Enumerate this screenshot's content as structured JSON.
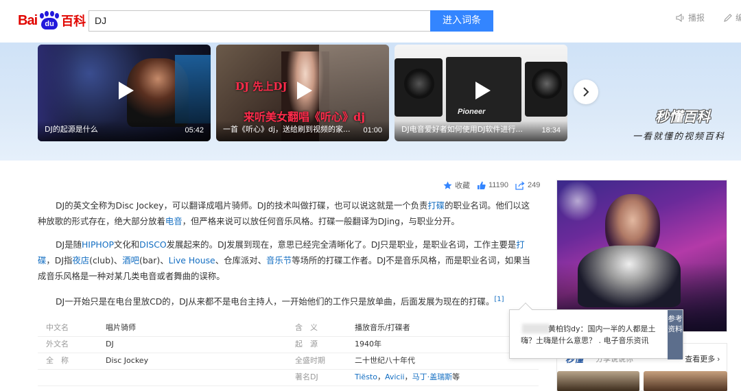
{
  "header": {
    "logo_text_left": "Bai",
    "logo_text_paw": "du",
    "logo_text_right": "百科",
    "search_value": "DJ",
    "search_button": "进入词条",
    "broadcast_label": "播报",
    "edit_label": "编"
  },
  "videos": [
    {
      "title": "DJ的起源是什么",
      "duration": "05:42",
      "overlay_1": "",
      "overlay_2": ""
    },
    {
      "title": "一首《听心》dj，送给刷到视频的家...",
      "duration": "01:00",
      "overlay_1": "DJ 先上DJ",
      "overlay_2": "来听美女翻唱《听心》dj"
    },
    {
      "title": "DJ电音爱好者如何使用DJ软件进行...",
      "duration": "18:34",
      "overlay_1": "",
      "overlay_2": "Pioneer"
    }
  ],
  "banner": {
    "brand": "秒懂百科",
    "slogan": "一看就懂的视频百科"
  },
  "stats": {
    "favorite_label": "收藏",
    "like_count": "11190",
    "share_count": "249"
  },
  "paragraphs": {
    "p1": [
      {
        "t": "DJ的英文全称为Disc Jockey，可以翻译成唱片骑师。DJ的技术叫做打碟，也可以说这就是一个负责"
      },
      {
        "t": "打碟",
        "link": true
      },
      {
        "t": "的职业名词。他们以这种放歌的形式存在，绝大部分放着"
      },
      {
        "t": "电音",
        "link": true
      },
      {
        "t": "，但严格来说可以放任何音乐风格。打碟一般翻译为DJing，与职业分开。"
      }
    ],
    "p2": [
      {
        "t": "DJ是随"
      },
      {
        "t": "HIPHOP",
        "link": true
      },
      {
        "t": "文化和"
      },
      {
        "t": "DISCO",
        "link": true
      },
      {
        "t": "发展起来的。DJ发展到现在，意思已经完全清晰化了。DJ只是职业，是职业名词，工作主要是"
      },
      {
        "t": "打碟",
        "link": true
      },
      {
        "t": "，DJ指"
      },
      {
        "t": "夜店",
        "link": true
      },
      {
        "t": "(club)、"
      },
      {
        "t": "酒吧",
        "link": true
      },
      {
        "t": "(bar)、"
      },
      {
        "t": "Live House",
        "link": true
      },
      {
        "t": "、仓库派对、"
      },
      {
        "t": "音乐节",
        "link": true
      },
      {
        "t": "等场所的打碟工作者。DJ不是音乐风格，而是职业名词，如果当成音乐风格是一种对某几类电音或者舞曲的误称。"
      }
    ],
    "p3": [
      {
        "t": "DJ一开始只是在电台里放CD的，DJ从来都不是电台主持人，一开始他们的工作只是放单曲，后面发展为现在的打碟。"
      },
      {
        "t": "[1]",
        "sup": true
      }
    ]
  },
  "basic_info": {
    "left": [
      {
        "key": "中文名",
        "value": "唱片骑师"
      },
      {
        "key": "外文名",
        "value": "DJ"
      },
      {
        "key": "全　称",
        "value": "Disc Jockey"
      }
    ],
    "right": [
      {
        "key": "含　义",
        "value": "播放音乐/打碟者"
      },
      {
        "key": "起　源",
        "value": "1940年"
      },
      {
        "key": "全盛时期",
        "value": "二十世纪八十年代"
      },
      {
        "key": "著名DJ",
        "value_links": [
          "Tiësto",
          "Avicii",
          "马丁·盖瑞斯"
        ],
        "value_suffix": "等"
      }
    ]
  },
  "tooltip": {
    "text": "黄柏钧dy：国内一半的人都是土嗨？土嗨是什么意思？ . 电子音乐资讯",
    "tab": "参考资料"
  },
  "side_card": {
    "more_label": "查看更多",
    "logo": "秒懂",
    "caption": "分享说说你"
  },
  "colors": {
    "accent": "#3385ff",
    "link": "#136ec2",
    "logo_red": "#e10601",
    "logo_blue": "#2319dc",
    "banner_bg": "#d6e7f8"
  }
}
